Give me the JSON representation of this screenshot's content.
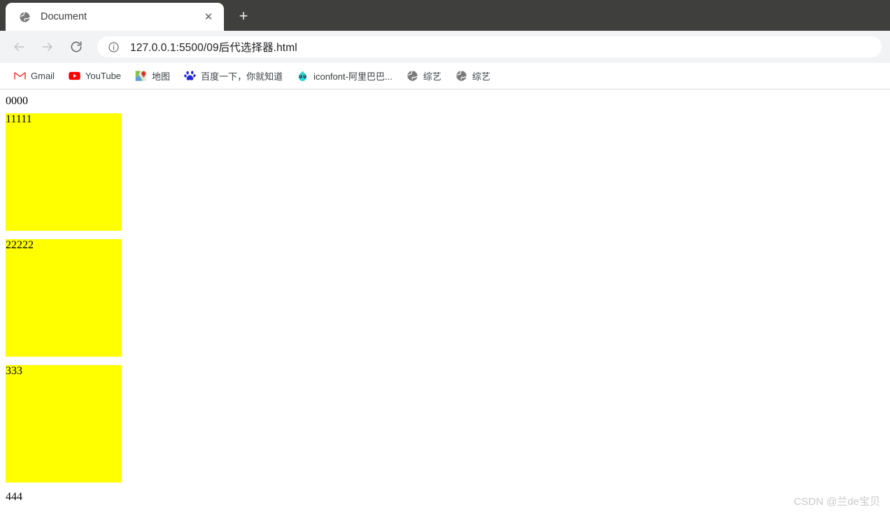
{
  "browser": {
    "tab": {
      "title": "Document",
      "favicon": "globe-icon",
      "close_label": "✕"
    },
    "new_tab_label": "+",
    "nav": {
      "back_label": "←",
      "forward_label": "→",
      "reload_label": "↻"
    },
    "omnibox": {
      "info_icon": "info-circle-icon",
      "url": "127.0.0.1:5500/09后代选择器.html",
      "placeholder": "Search Google or type a URL"
    },
    "bookmarks": [
      {
        "label": "Gmail",
        "icon": "gmail-icon"
      },
      {
        "label": "YouTube",
        "icon": "youtube-icon"
      },
      {
        "label": "地图",
        "icon": "google-maps-icon"
      },
      {
        "label": "百度一下，你就知道",
        "icon": "baidu-icon"
      },
      {
        "label": "iconfont-阿里巴巴...",
        "icon": "iconfont-icon"
      },
      {
        "label": "综艺",
        "icon": "globe-icon"
      },
      {
        "label": "综艺",
        "icon": "globe-icon"
      }
    ]
  },
  "page": {
    "intro_text": "0000",
    "boxes": [
      {
        "label": "11111",
        "color": "#ffff00"
      },
      {
        "label": "22222",
        "color": "#ffff00"
      },
      {
        "label": "333",
        "color": "#ffff00"
      }
    ],
    "outro_text": "444"
  },
  "watermark": {
    "text": "CSDN @兰de宝贝"
  }
}
